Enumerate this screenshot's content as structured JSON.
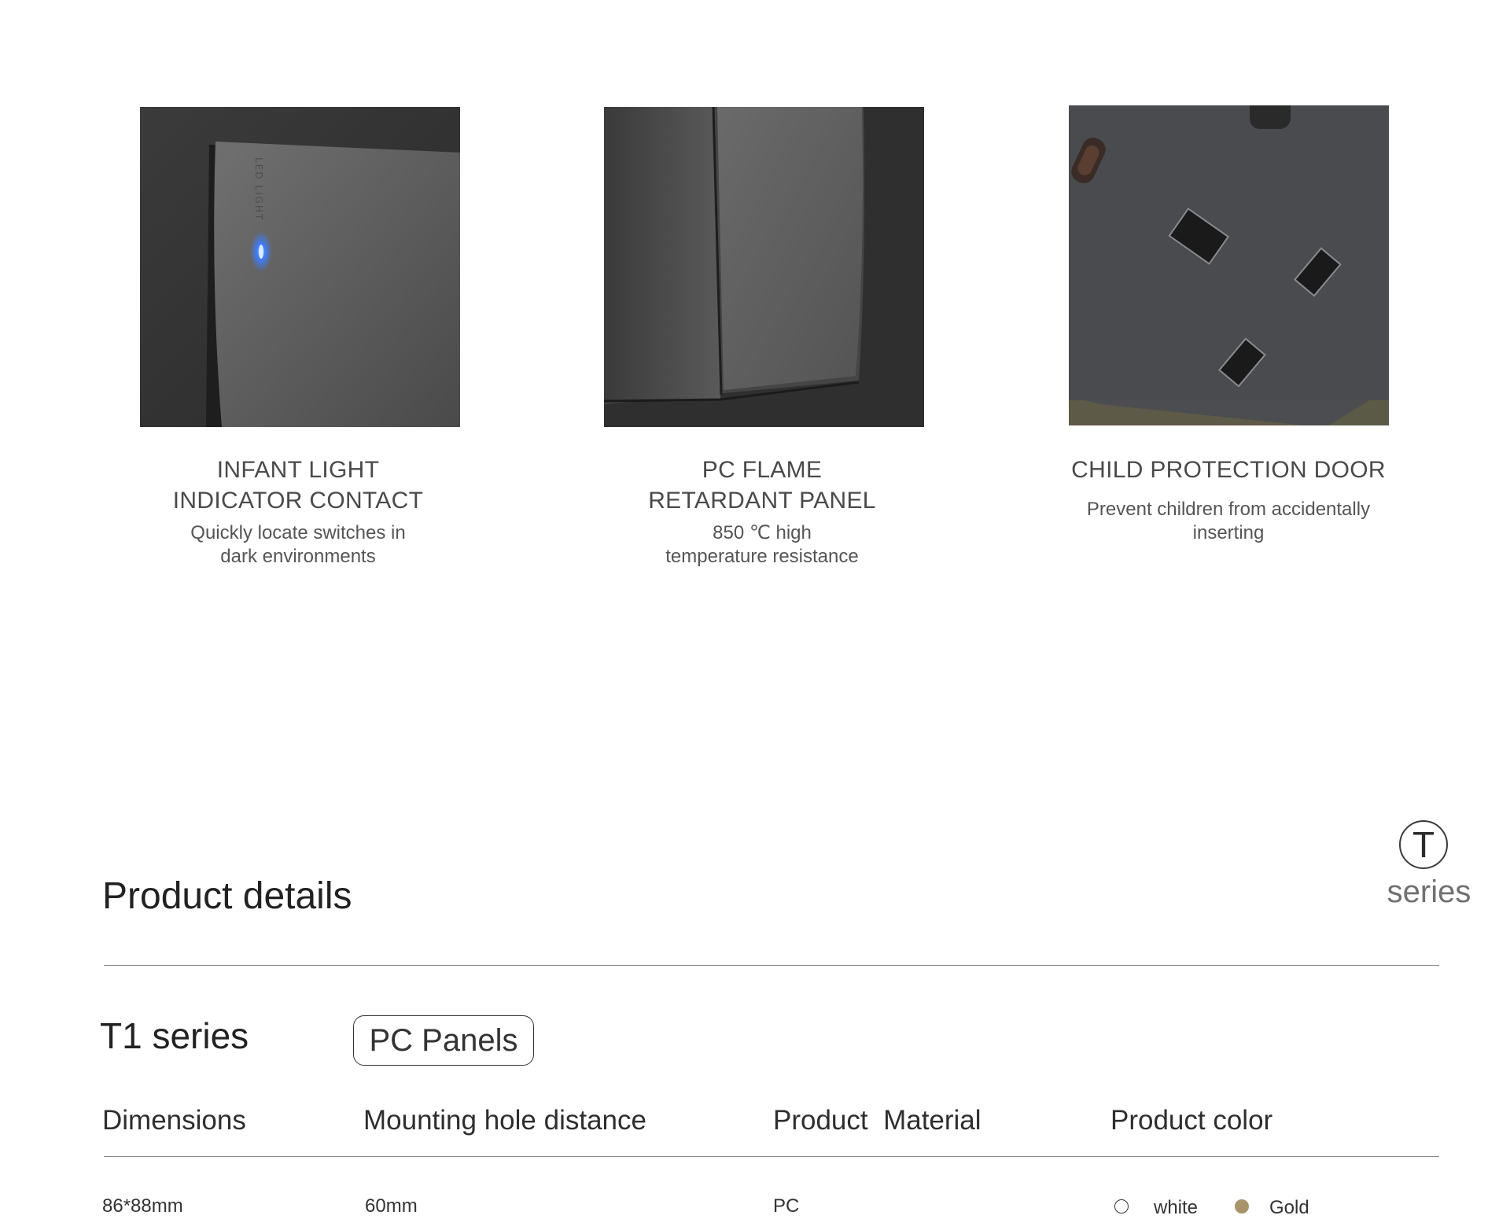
{
  "features": [
    {
      "title": "INFANT LIGHT\nINDICATOR CONTACT",
      "description": "Quickly locate switches in\ndark environments",
      "image_icon": "switch-with-blue-led-image",
      "image_text": "LED LIGHT"
    },
    {
      "title": "PC FLAME\nRETARDANT PANEL",
      "description": "850 ℃ high\ntemperature resistance",
      "image_icon": "double-rocker-panel-image"
    },
    {
      "title": "CHILD PROTECTION DOOR",
      "description": "Prevent children from accidentally\ninserting",
      "image_icon": "socket-outlet-image"
    }
  ],
  "series_badge": {
    "letter": "T",
    "label": "series"
  },
  "product_details": {
    "heading": "Product details",
    "series_name": "T1 series",
    "material_tag": "PC Panels",
    "columns": [
      {
        "header": "Dimensions",
        "value": "86*88mm"
      },
      {
        "header": "Mounting hole distance",
        "value": "60mm"
      },
      {
        "header": "Product  Material",
        "value": "PC"
      },
      {
        "header": "Product color"
      }
    ],
    "colors": [
      {
        "name": "white",
        "swatch": "#ffffff",
        "border": "#333333"
      },
      {
        "name": "Gold",
        "swatch": "#a8946b",
        "border": "#a8946b"
      }
    ]
  },
  "theme": {
    "text_dark": "#222222",
    "text_mid": "#4a4a4a",
    "divider": "#8a8a8a",
    "led_blue": "#3f7dff"
  }
}
